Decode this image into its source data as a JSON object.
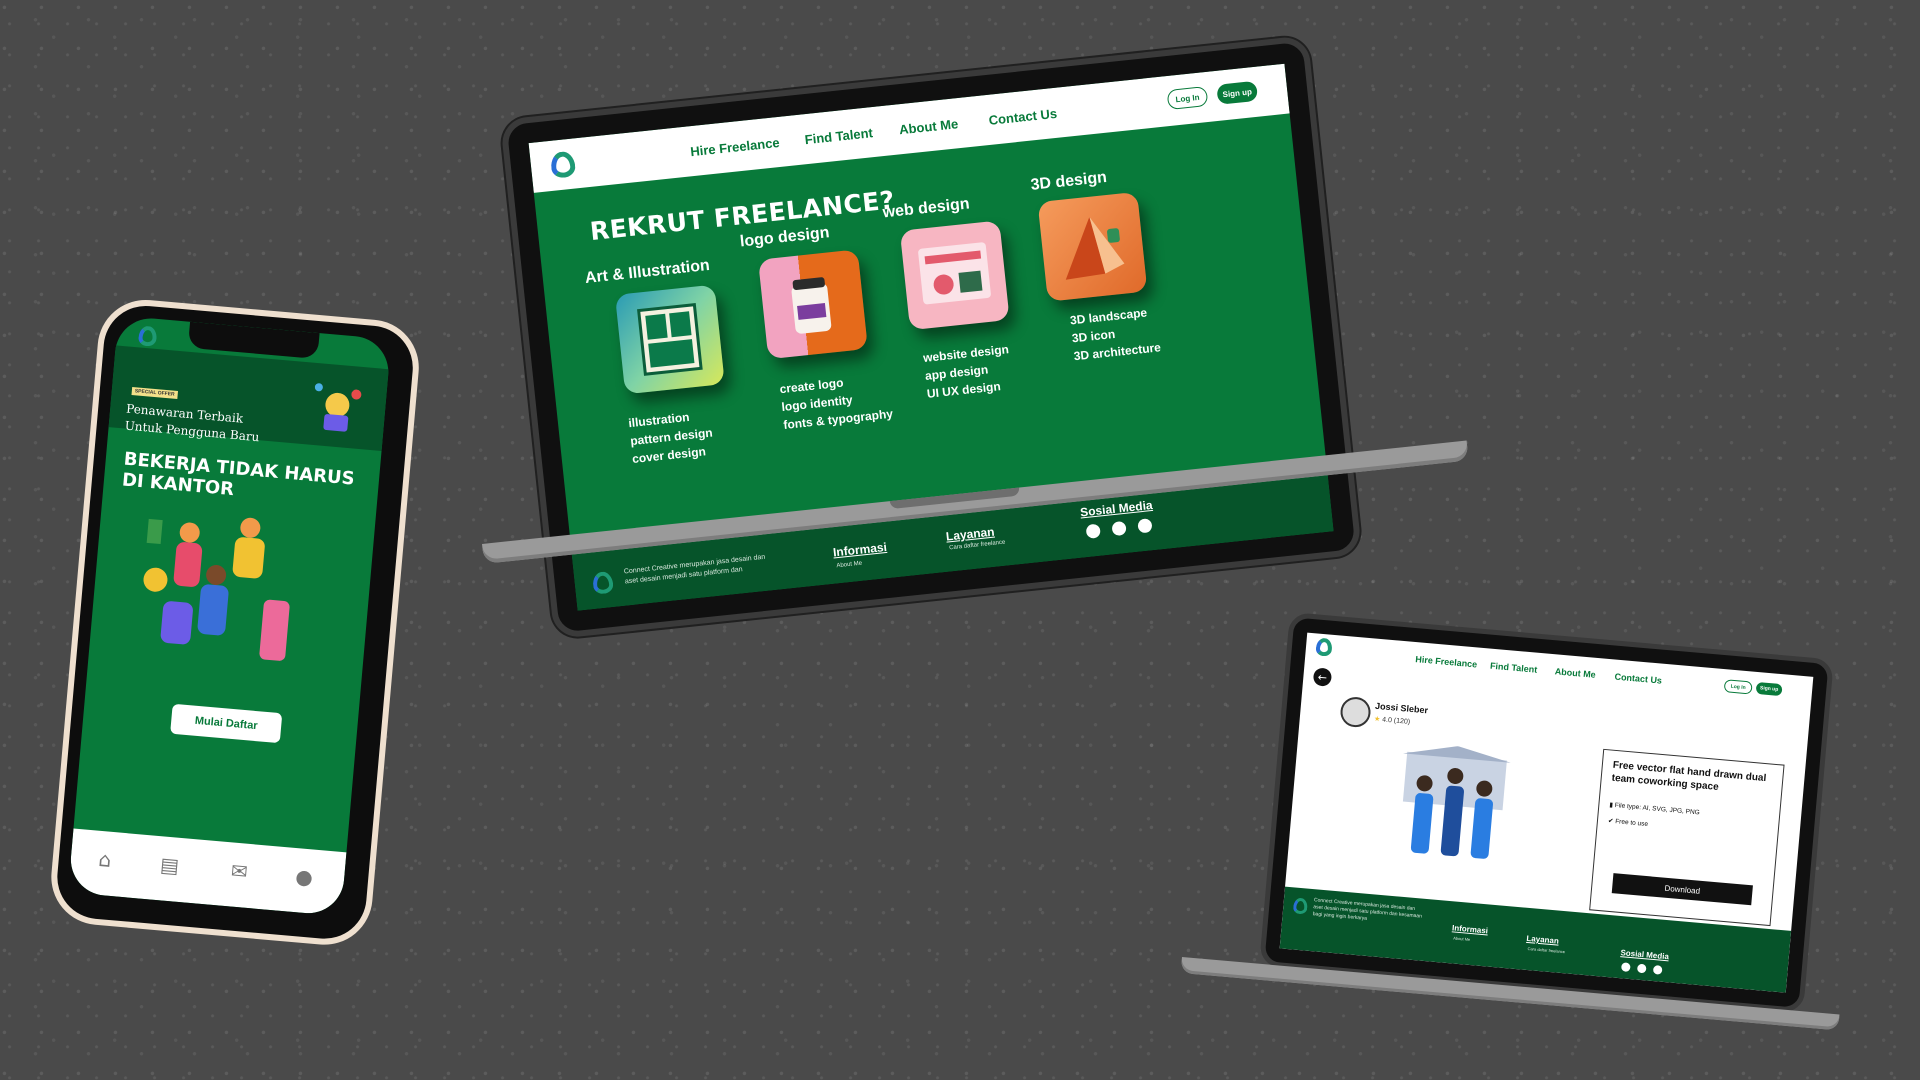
{
  "laptop": {
    "nav": {
      "links": [
        "Hire Freelance",
        "Find Talent",
        "About Me",
        "Contact Us"
      ],
      "login": "Log In",
      "signup": "Sign up"
    },
    "headline": "REKRUT FREELANCE?",
    "categories": [
      {
        "title": "Art & Illustration",
        "items": [
          "illustration",
          "pattern design",
          "cover design"
        ]
      },
      {
        "title": "logo design",
        "items": [
          "create logo",
          "logo identity",
          "fonts & typography"
        ]
      },
      {
        "title": "web design",
        "items": [
          "website design",
          "app design",
          "UI UX design"
        ]
      },
      {
        "title": "3D design",
        "items": [
          "3D  landscape",
          "3D  icon",
          "3D architecture"
        ]
      }
    ],
    "footer": {
      "description": "Connect Creative merupakan jasa desain dan aset desain menjadi satu platform dan",
      "informasi": "Informasi",
      "informasi_sub": "About Me",
      "layanan": "Layanan",
      "layanan_sub": "Cara daftar freelance",
      "sosial": "Sosial Media"
    }
  },
  "phone": {
    "badge": "SPECIAL OFFER",
    "promo": [
      "Penawaran Terbaik",
      "Untuk Pengguna Baru"
    ],
    "headline": "BEKERJA TIDAK HARUS DI KANTOR",
    "cta": "Mulai Daftar",
    "tabs": [
      "home-icon",
      "document-icon",
      "chat-icon",
      "profile-icon"
    ]
  },
  "small_laptop": {
    "nav": {
      "links": [
        "Hire Freelance",
        "Find Talent",
        "About Me",
        "Contact Us"
      ],
      "login": "Log In",
      "signup": "Sign up"
    },
    "author": "Jossi Sleber",
    "rating": "4.0  (120)",
    "card": {
      "title": "Free vector flat hand drawn dual team coworking space",
      "file_type": "File type: AI, SVG, JPG, PNG",
      "license": "Free to use",
      "download": "Download"
    },
    "footer": {
      "description": "Connect Creative merupakan jasa desain dan aset desain menjadi satu platform dan kesamaan bagi yang ingin berkarya",
      "informasi": "Informasi",
      "informasi_sub": "About Me",
      "layanan": "Layanan",
      "layanan_sub": "Cara daftar freelance",
      "sosial": "Sosial Media"
    }
  },
  "colors": {
    "brand_green": "#087a3a",
    "dark_green": "#06542a",
    "background": "#4a4a4a"
  }
}
